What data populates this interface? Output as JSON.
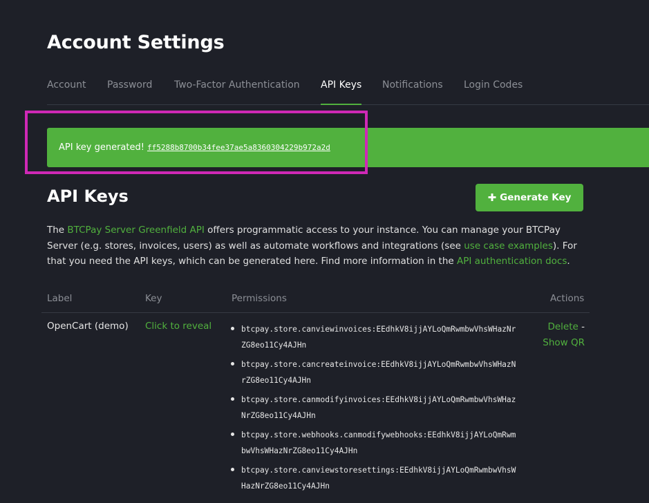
{
  "page": {
    "title": "Account Settings"
  },
  "tabs": [
    {
      "label": "Account",
      "active": false
    },
    {
      "label": "Password",
      "active": false
    },
    {
      "label": "Two-Factor Authentication",
      "active": false
    },
    {
      "label": "API Keys",
      "active": true
    },
    {
      "label": "Notifications",
      "active": false
    },
    {
      "label": "Login Codes",
      "active": false
    }
  ],
  "alert": {
    "text": "API key generated!",
    "key": "ff5288b8700b34fee37ae5a8360304229b972a2d"
  },
  "section": {
    "title": "API Keys",
    "generate_button": "Generate Key",
    "generate_icon": "plus-icon"
  },
  "description": {
    "p1": "The ",
    "link1": "BTCPay Server Greenfield API",
    "p2": " offers programmatic access to your instance. You can manage your BTCPay Server (e.g. stores, invoices, users) as well as automate workflows and integrations (see ",
    "link2": "use case examples",
    "p3": "). For that you need the API keys, which can be generated here. Find more information in the ",
    "link3": "API authentication docs",
    "p4": "."
  },
  "table": {
    "headers": {
      "label": "Label",
      "key": "Key",
      "permissions": "Permissions",
      "actions": "Actions"
    },
    "rows": [
      {
        "label": "OpenCart (demo)",
        "key": "Click to reveal",
        "permissions": [
          "btcpay.store.canviewinvoices:EEdhkV8ijjAYLoQmRwmbwVhsWHazNrZG8eo11Cy4AJHn",
          "btcpay.store.cancreateinvoice:EEdhkV8ijjAYLoQmRwmbwVhsWHazNrZG8eo11Cy4AJHn",
          "btcpay.store.canmodifyinvoices:EEdhkV8ijjAYLoQmRwmbwVhsWHazNrZG8eo11Cy4AJHn",
          "btcpay.store.webhooks.canmodifywebhooks:EEdhkV8ijjAYLoQmRwmbwVhsWHazNrZG8eo11Cy4AJHn",
          "btcpay.store.canviewstoresettings:EEdhkV8ijjAYLoQmRwmbwVhsWHazNrZG8eo11Cy4AJHn"
        ],
        "actions": {
          "delete": "Delete",
          "separator": " -",
          "show_qr": "Show QR"
        }
      }
    ]
  },
  "colors": {
    "accent": "#51b13e",
    "background": "#1e2028",
    "highlight": "#cf29b6"
  }
}
